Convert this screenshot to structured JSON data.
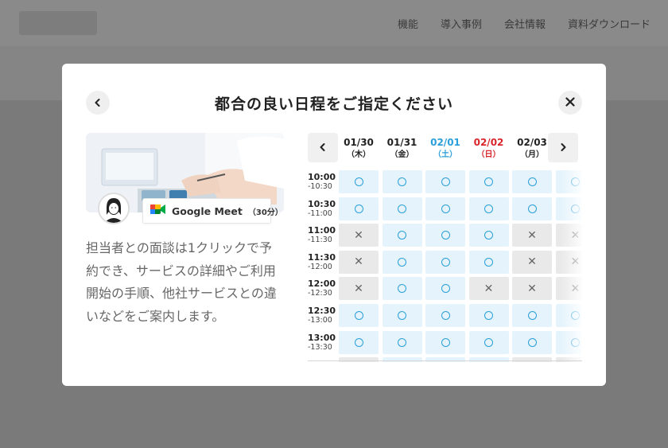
{
  "background": {
    "nav": [
      "機能",
      "導入事例",
      "会社情報",
      "資料ダウンロード"
    ]
  },
  "modal": {
    "title": "都合の良い日程をご指定ください",
    "back_icon": "chevron-left-icon",
    "close_icon": "close-icon",
    "meet": {
      "name": "Google Meet",
      "duration": "（30分）"
    },
    "description": "担当者との面談は1クリックで予約でき、サービスの詳細やご利用開始の手順、他社サービスとの違いなどをご案内します。"
  },
  "calendar": {
    "prev_icon": "chevron-left-icon",
    "next_icon": "chevron-right-icon",
    "days": [
      {
        "date": "01/30",
        "dow": "（木）",
        "type": "normal"
      },
      {
        "date": "01/31",
        "dow": "（金）",
        "type": "normal"
      },
      {
        "date": "02/01",
        "dow": "（土）",
        "type": "sat"
      },
      {
        "date": "02/02",
        "dow": "（日）",
        "type": "sun"
      },
      {
        "date": "02/03",
        "dow": "（月）",
        "type": "normal"
      },
      {
        "date": "",
        "dow": "",
        "type": "normal"
      }
    ],
    "times": [
      {
        "start": "10:00",
        "end": "-10:30"
      },
      {
        "start": "10:30",
        "end": "-11:00"
      },
      {
        "start": "11:00",
        "end": "-11:30"
      },
      {
        "start": "11:30",
        "end": "-12:00"
      },
      {
        "start": "12:00",
        "end": "-12:30"
      },
      {
        "start": "12:30",
        "end": "-13:00"
      },
      {
        "start": "13:00",
        "end": "-13:30"
      },
      {
        "start": "",
        "end": ""
      }
    ],
    "availability": [
      [
        "ok",
        "ok",
        "ok",
        "ok",
        "ok",
        "ok"
      ],
      [
        "ok",
        "ok",
        "ok",
        "ok",
        "ok",
        "ok"
      ],
      [
        "ng",
        "ok",
        "ok",
        "ok",
        "ng",
        "ng"
      ],
      [
        "ng",
        "ok",
        "ok",
        "ok",
        "ng",
        "ng"
      ],
      [
        "ng",
        "ok",
        "ok",
        "ng",
        "ng",
        "ng"
      ],
      [
        "ok",
        "ok",
        "ok",
        "ok",
        "ok",
        "ok"
      ],
      [
        "ok",
        "ok",
        "ok",
        "ok",
        "ok",
        "ok"
      ],
      [
        "ng",
        "ok",
        "ok",
        "ok",
        "ng",
        "ng"
      ]
    ],
    "symbols": {
      "ok": "",
      "ng": "✕"
    },
    "colors": {
      "available_bg": "#e4f3fc",
      "available_mark": "#2b9fd9",
      "unavailable_bg": "#e9e9e9",
      "saturday": "#2b9fd9",
      "sunday": "#d8262c"
    }
  }
}
